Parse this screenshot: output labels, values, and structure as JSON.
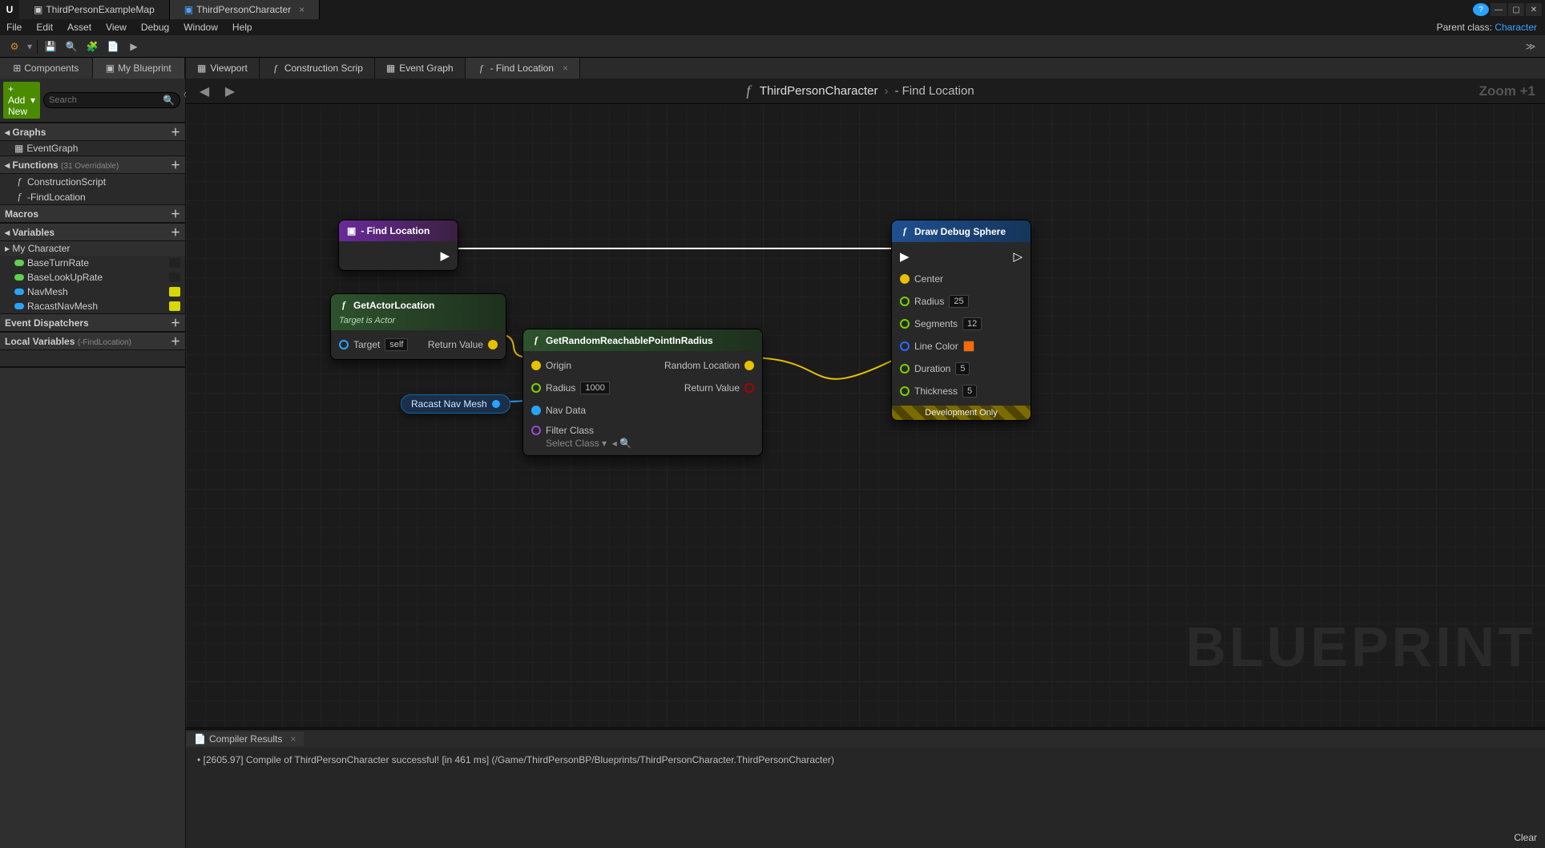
{
  "window": {
    "doc_tabs": [
      "ThirdPersonExampleMap",
      "ThirdPersonCharacter"
    ],
    "active_doc": 1,
    "parent_class_label": "Parent class:",
    "parent_class_value": "Character"
  },
  "menu": [
    "File",
    "Edit",
    "Asset",
    "View",
    "Debug",
    "Window",
    "Help"
  ],
  "side": {
    "subtabs": [
      "Components",
      "My Blueprint"
    ],
    "active_subtab": 1,
    "add_new": "+ Add New",
    "search_placeholder": "Search",
    "graphs_label": "Graphs",
    "event_graph": "EventGraph",
    "functions_label": "Functions",
    "functions_note": "(31 Overridable)",
    "fn_items": [
      "ConstructionScript",
      "-FindLocation"
    ],
    "macros_label": "Macros",
    "variables_label": "Variables",
    "var_group": "My Character",
    "vars": [
      {
        "name": "BaseTurnRate",
        "color": "#5bd24a",
        "vis": false
      },
      {
        "name": "BaseLookUpRate",
        "color": "#5bd24a",
        "vis": false
      },
      {
        "name": "NavMesh",
        "color": "#2aa3ff",
        "vis": true
      },
      {
        "name": "RacastNavMesh",
        "color": "#2aa3ff",
        "vis": true
      }
    ],
    "event_dispatchers": "Event Dispatchers",
    "local_vars_label": "Local Variables",
    "local_vars_note": "(-FindLocation)"
  },
  "graph_tabs": [
    {
      "label": "Viewport",
      "icon": "grid"
    },
    {
      "label": "Construction Scrip",
      "icon": "fn"
    },
    {
      "label": "Event Graph",
      "icon": "grid"
    },
    {
      "label": "- Find Location",
      "icon": "fn",
      "active": true
    }
  ],
  "breadcrumb": {
    "root": "ThirdPersonCharacter",
    "leaf": "- Find Location"
  },
  "zoom_text": "Zoom +1",
  "watermark": "BLUEPRINT",
  "nodes": {
    "entry": {
      "title": "- Find Location"
    },
    "actorloc": {
      "title": "GetActorLocation",
      "subtitle": "Target is Actor",
      "pin_target": "Target",
      "pin_self": "self",
      "pin_return": "Return Value"
    },
    "randreach": {
      "title": "GetRandomReachablePointInRadius",
      "origin": "Origin",
      "radius": "Radius",
      "radius_val": "1000",
      "navdata": "Nav Data",
      "filter": "Filter Class",
      "filter_val": "Select Class",
      "randloc": "Random Location",
      "retval": "Return Value"
    },
    "navmesh": "Racast Nav Mesh",
    "debugsphere": {
      "title": "Draw Debug Sphere",
      "center": "Center",
      "radius": "Radius",
      "radius_v": "25",
      "segments": "Segments",
      "segments_v": "12",
      "linecol": "Line Color",
      "linecol_v": "#ff6a00",
      "duration": "Duration",
      "duration_v": "5",
      "thickness": "Thickness",
      "thickness_v": "5",
      "dev": "Development Only"
    }
  },
  "compiler": {
    "tab": "Compiler Results",
    "msg": "[2605.97] Compile of ThirdPersonCharacter successful! [in 461 ms] (/Game/ThirdPersonBP/Blueprints/ThirdPersonCharacter.ThirdPersonCharacter)",
    "clear": "Clear"
  }
}
